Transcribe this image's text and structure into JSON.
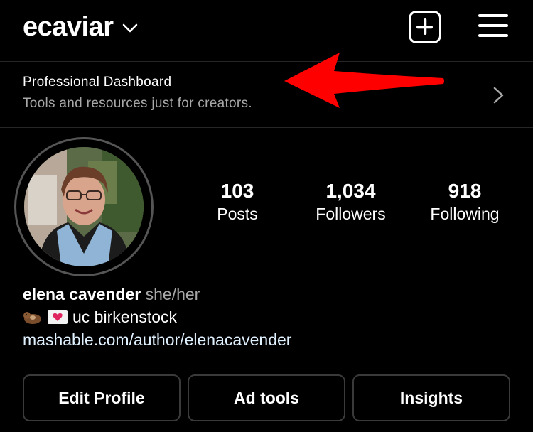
{
  "header": {
    "username": "ecaviar",
    "icons": {
      "account_switcher": "chevron-down-icon",
      "create": "plus-square-icon",
      "menu": "hamburger-menu-icon"
    }
  },
  "dashboard": {
    "title": "Professional Dashboard",
    "subtitle": "Tools and resources just for creators.",
    "annotation_color": "#ff0000"
  },
  "profile": {
    "stats": [
      {
        "value": "103",
        "label": "Posts"
      },
      {
        "value": "1,034",
        "label": "Followers"
      },
      {
        "value": "918",
        "label": "Following"
      }
    ],
    "bio": {
      "name": "elena cavender",
      "pronouns": "she/her",
      "emojis": [
        "otter-emoji",
        "heart-letter-emoji"
      ],
      "text": "uc birkenstock",
      "link": "mashable.com/author/elenacavender"
    }
  },
  "actions": {
    "edit_profile": "Edit Profile",
    "ad_tools": "Ad tools",
    "insights": "Insights"
  },
  "colors": {
    "background": "#000000",
    "text": "#ffffff",
    "secondary_text": "#a8a8a8",
    "link": "#e0f1ff",
    "button_border": "#3a3a3a"
  }
}
